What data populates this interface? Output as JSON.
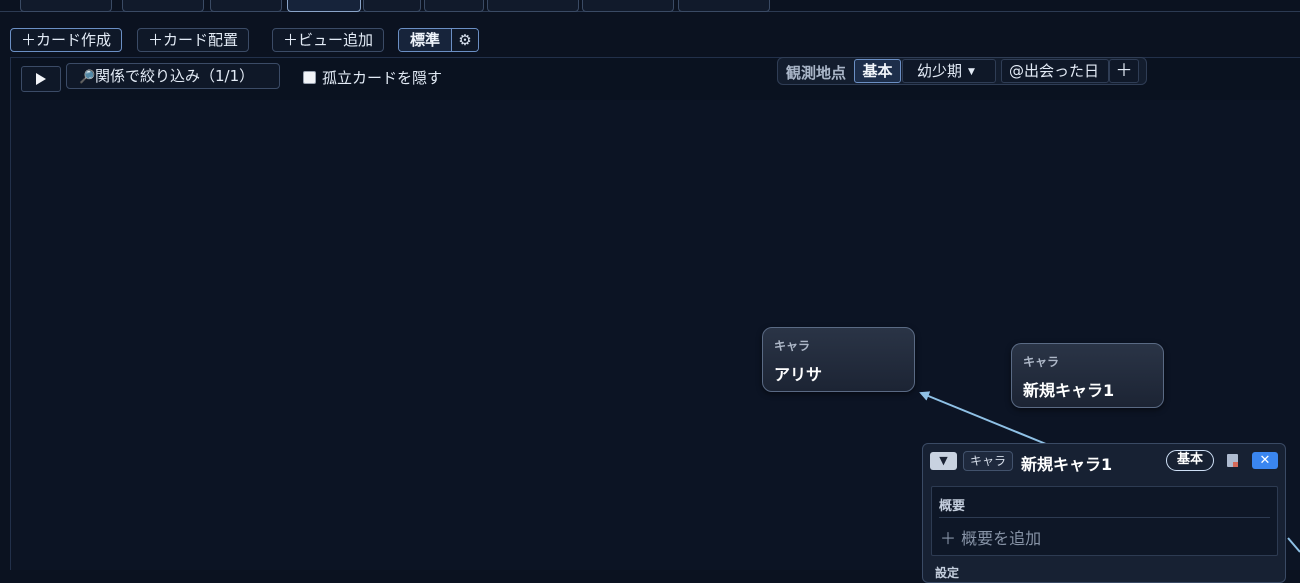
{
  "toolbar": {
    "create_card": "＋カード作成",
    "place_card": "＋カード配置",
    "add_view": "＋ビュー追加",
    "mode": "標準",
    "settings_icon": "gear-icon",
    "settings_glyph": "⚙"
  },
  "canvas_bar": {
    "play_icon": "play-icon",
    "filter_label": "関係で絞り込み（1/1）",
    "filter_icon": "magnifier-icon",
    "hide_isolated_label": "孤立カードを隠す",
    "hide_isolated_checked": false
  },
  "observation": {
    "label": "観測地点",
    "base": "基本",
    "period": "幼少期",
    "metric": "@出会った日",
    "add": "＋"
  },
  "cards": [
    {
      "type": "キャラ",
      "name": "アリサ"
    },
    {
      "type": "キャラ",
      "name": "新規キャラ1"
    }
  ],
  "panel": {
    "toggle": "▼",
    "type": "キャラ",
    "name": "新規キャラ1",
    "base_badge": "基本",
    "doc_icon": "document-icon",
    "close": "✕",
    "section_title": "概要",
    "add_summary": "＋ 概要を追加",
    "section2_title": "設定"
  },
  "colors": {
    "background": "#0b1220",
    "accent": "#3a86f0",
    "edge": "#8fc1e6"
  }
}
